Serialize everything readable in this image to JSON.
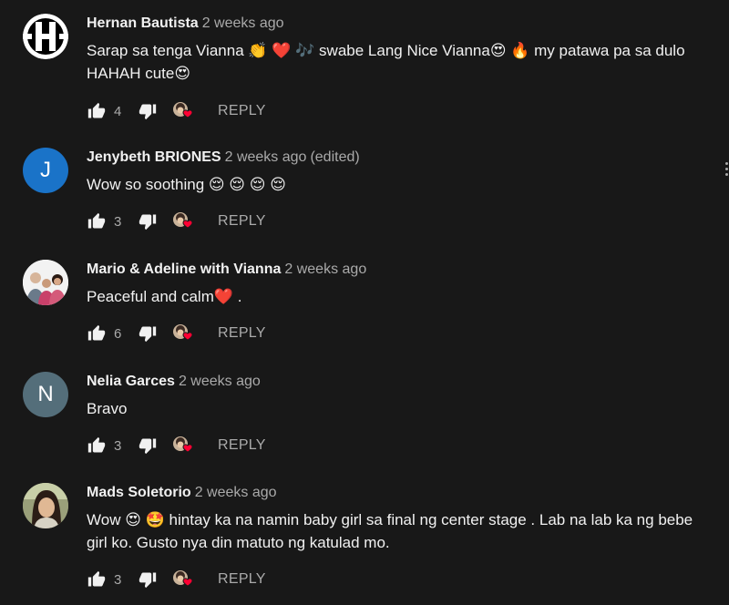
{
  "comments": [
    {
      "author": "Hernan Bautista",
      "time": "2 weeks ago",
      "edited": "",
      "text": "Sarap sa tenga Vianna 👏 ❤️ 🎶  swabe Lang Nice Vianna😍 🔥 my patawa pa sa dulo HAHAH cute😍",
      "likes": "4",
      "avatar_icon": "hb-logo-icon",
      "avatar_bg": "#ffffff"
    },
    {
      "author": "Jenybeth BRIONES",
      "time": "2 weeks ago",
      "edited": "(edited)",
      "text": "Wow so soothing 😌 😌 😌 😌",
      "likes": "3",
      "avatar_letter": "J",
      "avatar_bg": "#1a73c8"
    },
    {
      "author": "Mario & Adeline with Vianna",
      "time": "2 weeks ago",
      "edited": "",
      "text": "Peaceful and calm❤️ .",
      "likes": "6",
      "avatar_icon": "family-photo-icon",
      "avatar_bg": "#eeeeee"
    },
    {
      "author": "Nelia Garces",
      "time": "2 weeks ago",
      "edited": "",
      "text": "Bravo",
      "likes": "3",
      "avatar_letter": "N",
      "avatar_bg": "#546e7a"
    },
    {
      "author": "Mads Soletorio",
      "time": "2 weeks ago",
      "edited": "",
      "text": "Wow 😍 🤩  hintay ka na namin baby girl sa final ng center stage . Lab na lab ka ng bebe girl ko. Gusto nya din matuto ng katulad mo.",
      "likes": "3",
      "avatar_icon": "user-photo-icon",
      "avatar_bg": "#8a8f70"
    }
  ],
  "reply_label": "REPLY",
  "colors": {
    "background": "#181818",
    "text": "#f1f1f1",
    "secondary": "#aaaaaa",
    "heart": "#ff0033"
  }
}
